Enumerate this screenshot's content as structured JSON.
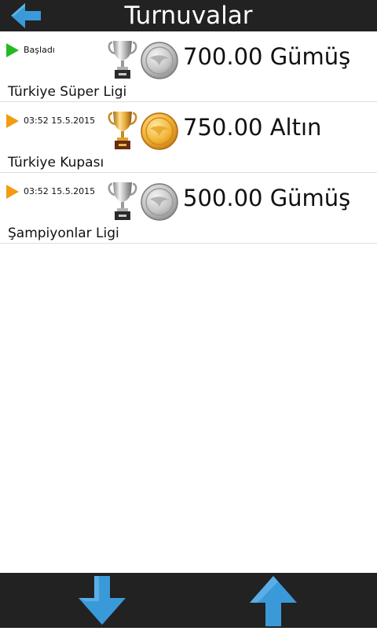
{
  "header": {
    "title": "Turnuvalar",
    "back_icon": "back-arrow-icon"
  },
  "tournaments": [
    {
      "status": "Başladı",
      "status_color": "#22bb22",
      "trophy": "silver",
      "coin": "silver",
      "prize": "700.00 Gümüş",
      "name": "Türkiye Süper Ligi"
    },
    {
      "status": "03:52 15.5.2015",
      "status_color": "#f39c12",
      "trophy": "gold",
      "coin": "gold",
      "prize": "750.00 Altın",
      "name": "Türkiye Kupası"
    },
    {
      "status": "03:52 15.5.2015",
      "status_color": "#f39c12",
      "trophy": "silver",
      "coin": "silver",
      "prize": "500.00 Gümüş",
      "name": "Şampiyonlar Ligi"
    }
  ],
  "footer": {
    "down_icon": "down-arrow-icon",
    "up_icon": "up-arrow-icon"
  },
  "colors": {
    "bar_background": "#222222",
    "arrow_blue": "#3a9ad9",
    "divider": "#dedede"
  }
}
